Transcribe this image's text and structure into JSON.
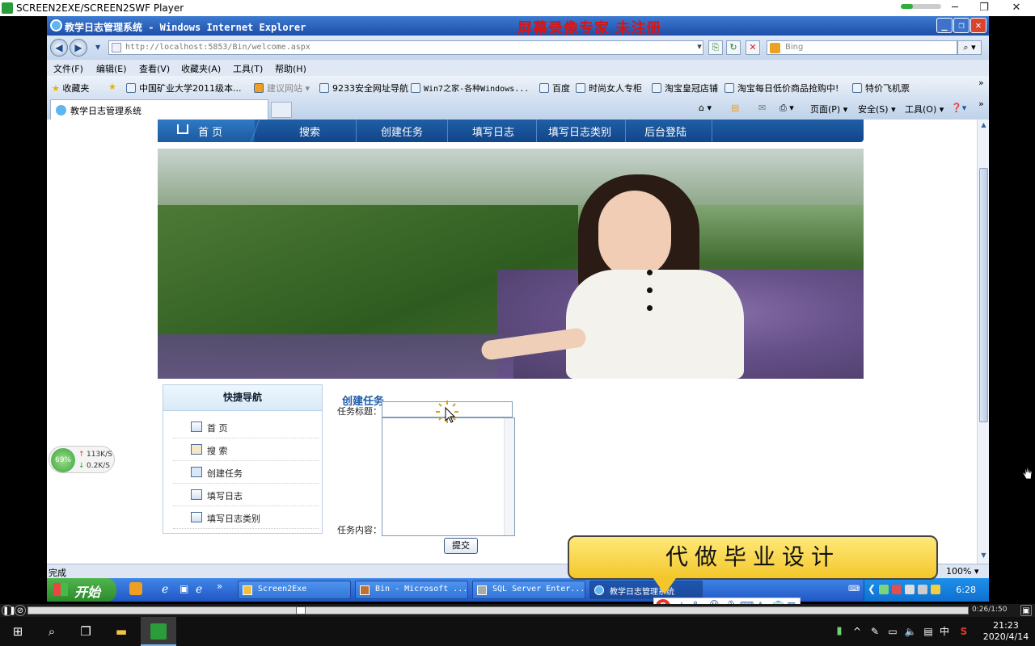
{
  "player": {
    "title": "SCREEN2EXE/SCREEN2SWF Player",
    "progress_fraction": 0.29,
    "time": "0:26/1:50"
  },
  "ie": {
    "title": "教学日志管理系统 - Windows Internet Explorer",
    "watermark": "屏幕录像专家 未注册",
    "address": "http://localhost:5853/Bin/welcome.aspx",
    "search_placeholder": "Bing",
    "menu": [
      "文件(F)",
      "编辑(E)",
      "查看(V)",
      "收藏夹(A)",
      "工具(T)",
      "帮助(H)"
    ],
    "favorites_label": "收藏夹",
    "favorites": [
      "中国矿业大学2011级本...",
      "建议网站",
      "9233安全网址导航",
      "Win7之家-各种Windows...",
      "百度",
      "时尚女人专柜",
      "淘宝皇冠店铺",
      "淘宝每日低价商品抢购中!",
      "特价飞机票"
    ],
    "tab_title": "教学日志管理系统",
    "commands": [
      "页面(P)",
      "安全(S)",
      "工具(O)"
    ],
    "status": "完成",
    "zoom": "100%"
  },
  "site": {
    "nav": [
      "首 页",
      "搜索",
      "创建任务",
      "填写日志",
      "填写日志类别",
      "后台登陆"
    ],
    "sidebar_title": "快捷导航",
    "sidebar_items": [
      "首    页",
      "搜    索",
      "创建任务",
      "填写日志",
      "填写日志类别"
    ],
    "form_title": "创建任务",
    "label_title": "任务标题：",
    "label_content": "任务内容：",
    "submit": "提交"
  },
  "netwidget": {
    "percent": "69%",
    "up": "113K/S",
    "down": "0.2K/S"
  },
  "ad_text": "代做毕业设计",
  "xp": {
    "start": "开始",
    "tasks": [
      "Screen2Exe",
      "Bin - Microsoft ...",
      "SQL Server Enter...",
      "教学日志管理系统"
    ],
    "time": "6:28"
  },
  "ime": {
    "label": "中"
  },
  "win10": {
    "ime": "中",
    "time": "21:23",
    "date": "2020/4/14"
  }
}
